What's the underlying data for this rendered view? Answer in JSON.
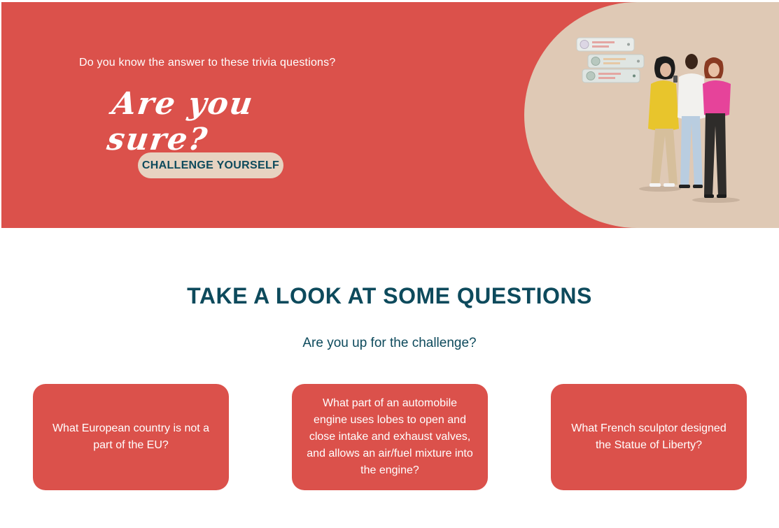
{
  "hero": {
    "kicker": "Do you know the answer to these trivia questions?",
    "script_title": "Are you sure?",
    "cta_label": "CHALLENGE YOURSELF",
    "illustration_icon": "people-with-phones-illustration"
  },
  "section": {
    "title": "TAKE A LOOK AT SOME QUESTIONS",
    "subtitle": "Are you up for the challenge?"
  },
  "cards": [
    {
      "question": "What European country is not a part of the EU?"
    },
    {
      "question": "What part of an automobile engine uses lobes to open and close intake and exhaust valves, and allows an air/fuel mixture into the engine?"
    },
    {
      "question": "What French sculptor designed the Statue of Liberty?"
    }
  ],
  "colors": {
    "hero_red": "#db514b",
    "hero_beige": "#dfc9b5",
    "button_beige": "#e7d3c1",
    "heading_teal": "#0d4a5c",
    "white": "#ffffff"
  }
}
